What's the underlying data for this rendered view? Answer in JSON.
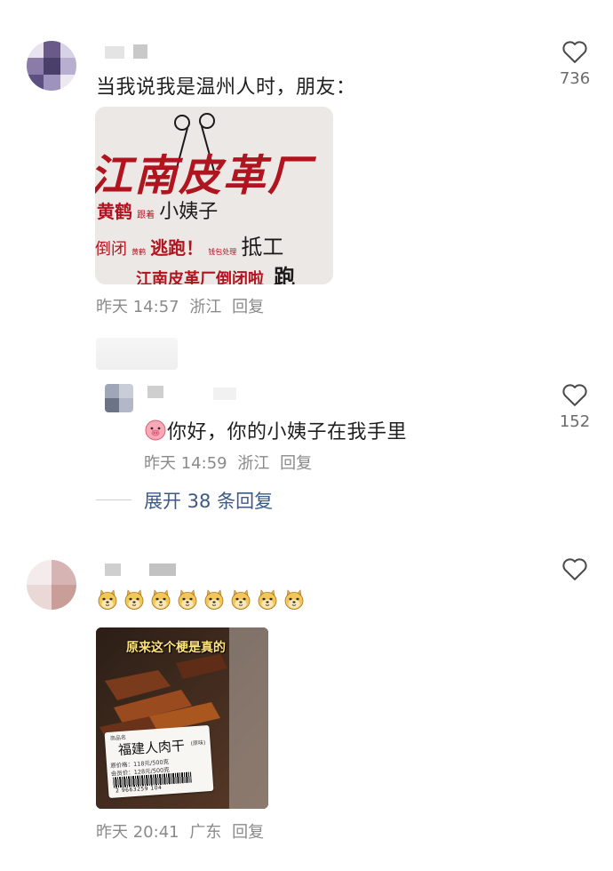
{
  "comments": [
    {
      "text": "当我说我是温州人时，朋友：",
      "time": "昨天 14:57",
      "location": "浙江",
      "reply_label": "回复",
      "likes": "736",
      "image": {
        "headline": "江南皮革厂",
        "line2_a": "黄鹤",
        "line2_small": "跟着",
        "line2_b": "小姨子",
        "line3_a": "倒闭",
        "line3_small": "黄鹤",
        "line3_b": "逃跑！",
        "line3_small2": "钱包处理",
        "line3_c": "抵工",
        "line4_a": "江南皮革厂倒闭啦",
        "line4_b": "跑"
      }
    },
    {
      "text": "你好，你的小姨子在我手里",
      "time": "昨天 14:59",
      "location": "浙江",
      "reply_label": "回复",
      "likes": "152",
      "expand_label": "展开 38 条回复"
    },
    {
      "emoji_count": 8,
      "time": "昨天 20:41",
      "location": "广东",
      "reply_label": "回复",
      "image": {
        "caption": "原来这个梗是真的",
        "label_title": "福建人肉干",
        "label_note": "(原味)",
        "price1": "原价格：118元/500克",
        "price2": "会员价：128元/500克",
        "barcode": "2 9663259 104",
        "label_top": "商品名"
      }
    }
  ],
  "colors": {
    "accent_link": "#3d5a87",
    "meta_gray": "#8a8a8a",
    "poster_red": "#b0141e"
  },
  "icons": [
    "heart-outline-icon",
    "smiling-pig-emoji",
    "doge-emoji"
  ]
}
